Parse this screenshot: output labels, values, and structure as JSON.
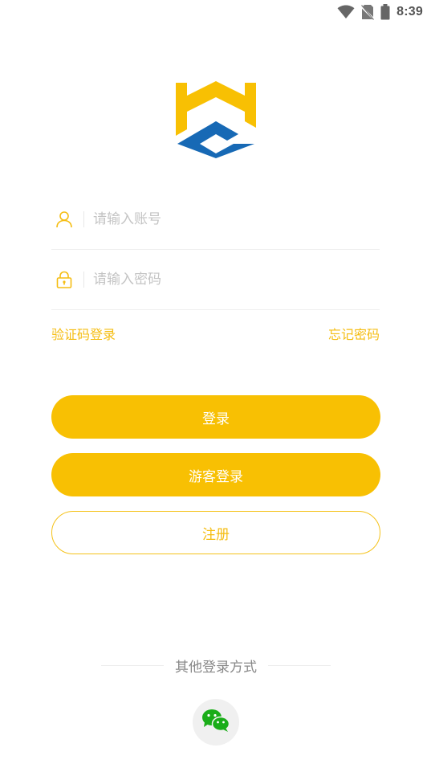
{
  "status_bar": {
    "time": "8:39",
    "icons": [
      "wifi-icon",
      "no-sim-icon",
      "battery-icon"
    ]
  },
  "colors": {
    "accent": "#f8c003",
    "link": "#f5bd12",
    "logo_blue": "#1769b5",
    "wechat_green": "#1aad19"
  },
  "form": {
    "account_placeholder": "请输入账号",
    "password_placeholder": "请输入密码",
    "account_icon": "user-icon",
    "password_icon": "lock-icon"
  },
  "links": {
    "sms_login": "验证码登录",
    "forgot_password": "忘记密码"
  },
  "buttons": {
    "login": "登录",
    "guest_login": "游客登录",
    "register": "注册"
  },
  "other_login": {
    "title": "其他登录方式",
    "wechat_icon": "wechat-icon"
  }
}
